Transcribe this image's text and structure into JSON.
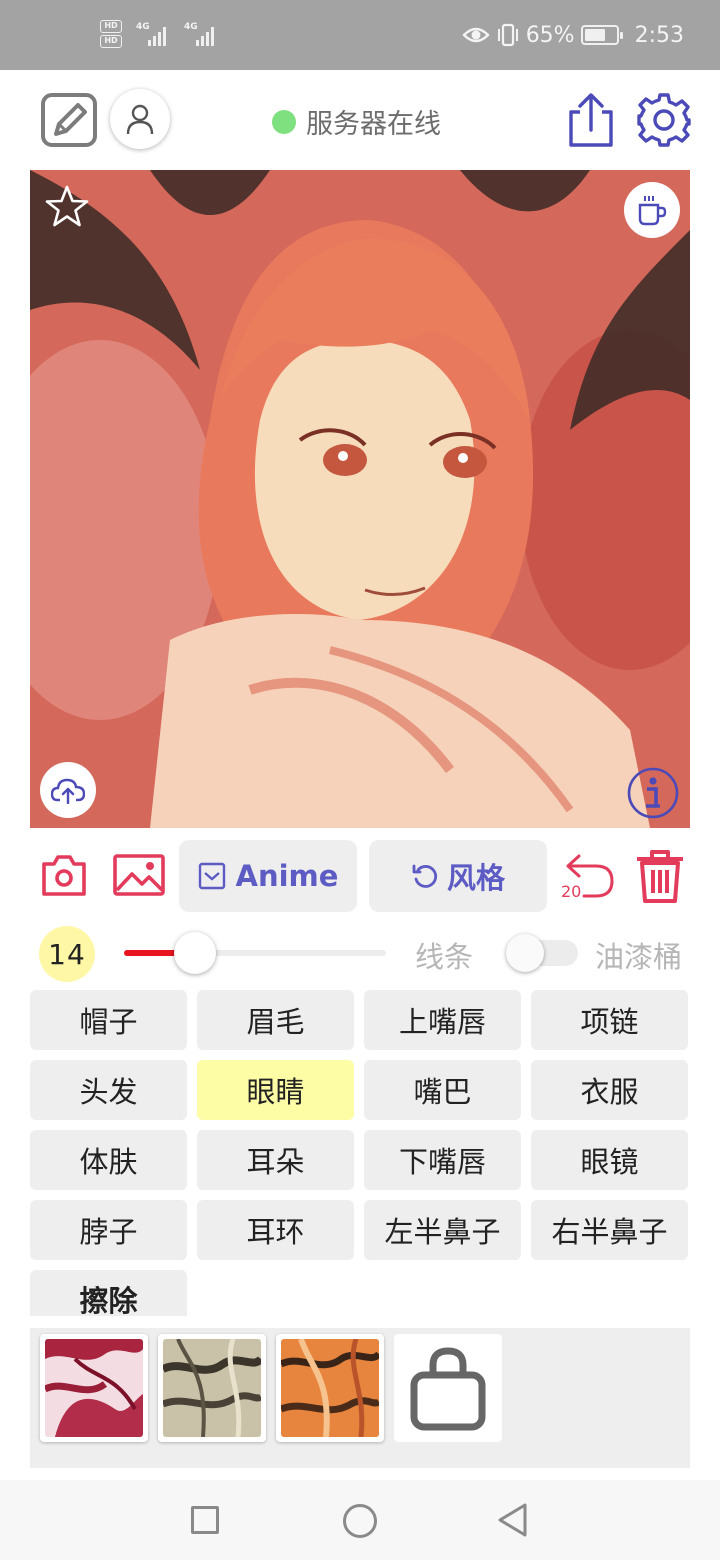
{
  "status_bar": {
    "hd1": "HD",
    "hd2": "HD",
    "net1": "4G",
    "net2": "4G",
    "battery_percent": "65%",
    "battery_level": 0.65,
    "time": "2:53"
  },
  "toolbar": {
    "server_status": "服务器在线",
    "server_status_color": "#7fe07f",
    "accent_color": "#5d5bc4"
  },
  "canvas": {
    "icons": [
      "star-icon",
      "coffee-icon",
      "cloud-upload-icon",
      "info-icon"
    ]
  },
  "actions": {
    "anime_label": "Anime",
    "style_label": "风格",
    "undo_count": "20",
    "danger_color": "#e33b5c"
  },
  "brush": {
    "size": "14",
    "slider_value": 0.27,
    "lines_label": "线条",
    "bucket_label": "油漆桶",
    "bucket_enabled": false
  },
  "parts": [
    {
      "label": "帽子",
      "active": false
    },
    {
      "label": "眉毛",
      "active": false
    },
    {
      "label": "上嘴唇",
      "active": false
    },
    {
      "label": "项链",
      "active": false
    },
    {
      "label": "头发",
      "active": false
    },
    {
      "label": "眼睛",
      "active": true
    },
    {
      "label": "嘴巴",
      "active": false
    },
    {
      "label": "衣服",
      "active": false
    },
    {
      "label": "体肤",
      "active": false
    },
    {
      "label": "耳朵",
      "active": false
    },
    {
      "label": "下嘴唇",
      "active": false
    },
    {
      "label": "眼镜",
      "active": false
    },
    {
      "label": "脖子",
      "active": false
    },
    {
      "label": "耳环",
      "active": false
    },
    {
      "label": "左半鼻子",
      "active": false
    },
    {
      "label": "右半鼻子",
      "active": false
    }
  ],
  "erase_label": "擦除",
  "styles": {
    "thumbnails": [
      "style-thumbnail-crimson",
      "style-thumbnail-sepia",
      "style-thumbnail-orange"
    ]
  }
}
